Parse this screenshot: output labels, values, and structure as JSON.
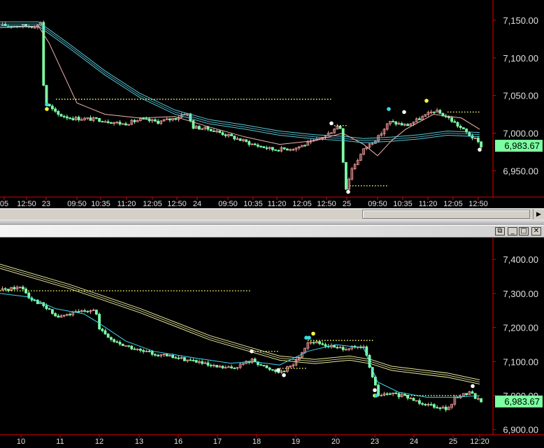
{
  "colors": {
    "background": "#000000",
    "axis": "#e00000",
    "axis_text": "#e0e0e0",
    "up_candle": "#f09a9a",
    "down_candle": "#7dffa6",
    "ma_band": "#57c7d8",
    "ma_slow": "#e7e79c",
    "fast_line_top": "#f4b3b3",
    "fast_line_bottom": "#3bd6f0",
    "level": "#ffff66",
    "last_price_bg": "#7bffa0",
    "dot_cyan": "#33dddd",
    "dot_yellow": "#ffff33",
    "dot_white": "#ffffff"
  },
  "icons": {
    "scroll_right": "triangle-right-icon",
    "restore": "restore-icon",
    "minimize": "minimize-icon",
    "maximize": "maximize-icon",
    "close": "close-icon"
  },
  "window_controls": {
    "restore": "⧉",
    "minimize": "_",
    "maximize": "□",
    "close": "✕"
  },
  "scroll_right_glyph": "▶",
  "chart_data": [
    {
      "type": "candlestick",
      "ylim": [
        6915,
        7175
      ],
      "grid": false,
      "y_ticks": [
        7150,
        7100,
        7050,
        7000,
        6950
      ],
      "y_tick_labels": [
        "7,150.00",
        "7,100.00",
        "7,050.00",
        "7,000.00",
        "6,950.00"
      ],
      "last_price": 6983.67,
      "last_price_label": "6,983.67",
      "x_labels": [
        "05",
        "12:50",
        "23",
        "09:50",
        "10:35",
        "11:20",
        "12:05",
        "12:50",
        "24",
        "09:50",
        "10:35",
        "11:20",
        "12:05",
        "12:50",
        "25",
        "09:50",
        "10:35",
        "11:20",
        "12:05",
        "12:50"
      ],
      "close_path": [
        [
          0,
          7143
        ],
        [
          20,
          7143
        ],
        [
          40,
          7142
        ],
        [
          55,
          7143
        ],
        [
          56,
          7162
        ],
        [
          60,
          7070
        ],
        [
          64,
          7040
        ],
        [
          80,
          7025
        ],
        [
          100,
          7020
        ],
        [
          140,
          7018
        ],
        [
          175,
          7012
        ],
        [
          200,
          7018
        ],
        [
          225,
          7015
        ],
        [
          250,
          7020
        ],
        [
          265,
          7028
        ],
        [
          275,
          7008
        ],
        [
          300,
          7005
        ],
        [
          330,
          6995
        ],
        [
          360,
          6985
        ],
        [
          390,
          6978
        ],
        [
          420,
          6980
        ],
        [
          450,
          6990
        ],
        [
          470,
          7000
        ],
        [
          480,
          7010
        ],
        [
          488,
          7005
        ],
        [
          490,
          6935
        ],
        [
          494,
          6925
        ],
        [
          500,
          6950
        ],
        [
          510,
          6965
        ],
        [
          520,
          6980
        ],
        [
          540,
          6995
        ],
        [
          555,
          7015
        ],
        [
          580,
          7010
        ],
        [
          600,
          7020
        ],
        [
          620,
          7030
        ],
        [
          640,
          7020
        ],
        [
          660,
          7005
        ],
        [
          680,
          6990
        ],
        [
          686,
          6983
        ]
      ],
      "series": [
        {
          "values": [
            [
              0,
              7145
            ],
            [
              55,
              7145
            ],
            [
              100,
              7115
            ],
            [
              150,
              7080
            ],
            [
              200,
              7050
            ],
            [
              250,
              7028
            ],
            [
              300,
              7015
            ],
            [
              350,
              7008
            ],
            [
              400,
              7000
            ],
            [
              450,
              6995
            ],
            [
              490,
              6993
            ],
            [
              520,
              6990
            ],
            [
              560,
              6992
            ],
            [
              600,
              6995
            ],
            [
              640,
              7000
            ],
            [
              686,
              6998
            ]
          ],
          "style": "band",
          "color": "#57c7d8"
        },
        {
          "values": [
            [
              0,
              7140
            ],
            [
              55,
              7142
            ],
            [
              70,
              7120
            ],
            [
              90,
              7080
            ],
            [
              110,
              7040
            ],
            [
              150,
              7025
            ],
            [
              200,
              7020
            ],
            [
              250,
              7022
            ],
            [
              300,
              7008
            ],
            [
              350,
              6995
            ],
            [
              400,
              6985
            ],
            [
              450,
              6990
            ],
            [
              490,
              7000
            ],
            [
              520,
              6985
            ],
            [
              540,
              6970
            ],
            [
              560,
              6990
            ],
            [
              580,
              7005
            ],
            [
              620,
              7025
            ],
            [
              660,
              7020
            ],
            [
              686,
              7005
            ]
          ],
          "style": "line",
          "color": "#f4b3b3"
        }
      ],
      "levels": [
        {
          "y": 7045,
          "x": [
            80,
            476
          ]
        },
        {
          "y": 7010,
          "x": [
            478,
            498
          ]
        },
        {
          "y": 6930,
          "x": [
            500,
            556
          ]
        },
        {
          "y": 7028,
          "x": [
            640,
            688
          ]
        }
      ],
      "markers": [
        {
          "x": 67,
          "y": 7038,
          "color": "cyan"
        },
        {
          "x": 67,
          "y": 7032,
          "color": "yellow"
        },
        {
          "x": 474,
          "y": 7013,
          "color": "white"
        },
        {
          "x": 498,
          "y": 6922,
          "color": "white"
        },
        {
          "x": 556,
          "y": 7032,
          "color": "cyan"
        },
        {
          "x": 578,
          "y": 7028,
          "color": "white"
        },
        {
          "x": 610,
          "y": 7043,
          "color": "yellow"
        },
        {
          "x": 686,
          "y": 6978,
          "color": "white"
        }
      ]
    },
    {
      "type": "candlestick",
      "ylim": [
        6885,
        7460
      ],
      "grid": false,
      "y_ticks": [
        7400,
        7300,
        7200,
        7100,
        7000,
        6900
      ],
      "y_tick_labels": [
        "7,400.00",
        "7,300.00",
        "7,200.00",
        "7,100.00",
        "7,000.00",
        "6,900.00"
      ],
      "last_price": 6983.67,
      "last_price_label": "6,983.67",
      "x_labels": [
        "10",
        "11",
        "12",
        "13",
        "16",
        "17",
        "18",
        "19",
        "20",
        "23",
        "24",
        "25",
        "12:20"
      ],
      "close_path": [
        [
          0,
          7310
        ],
        [
          30,
          7320
        ],
        [
          40,
          7290
        ],
        [
          60,
          7265
        ],
        [
          80,
          7230
        ],
        [
          100,
          7240
        ],
        [
          120,
          7250
        ],
        [
          135,
          7255
        ],
        [
          140,
          7195
        ],
        [
          160,
          7160
        ],
        [
          200,
          7130
        ],
        [
          240,
          7115
        ],
        [
          280,
          7100
        ],
        [
          300,
          7085
        ],
        [
          330,
          7080
        ],
        [
          360,
          7105
        ],
        [
          380,
          7080
        ],
        [
          400,
          7070
        ],
        [
          420,
          7095
        ],
        [
          440,
          7160
        ],
        [
          460,
          7150
        ],
        [
          480,
          7140
        ],
        [
          500,
          7140
        ],
        [
          520,
          7140
        ],
        [
          530,
          7060
        ],
        [
          540,
          7000
        ],
        [
          560,
          7005
        ],
        [
          580,
          6995
        ],
        [
          600,
          6980
        ],
        [
          620,
          6970
        ],
        [
          640,
          6960
        ],
        [
          650,
          6995
        ],
        [
          670,
          7010
        ],
        [
          686,
          6983
        ]
      ],
      "series": [
        {
          "values": [
            [
              0,
              7380
            ],
            [
              100,
              7320
            ],
            [
              200,
              7250
            ],
            [
              300,
              7170
            ],
            [
              400,
              7110
            ],
            [
              450,
              7100
            ],
            [
              500,
              7110
            ],
            [
              530,
              7100
            ],
            [
              560,
              7080
            ],
            [
              600,
              7070
            ],
            [
              640,
              7060
            ],
            [
              686,
              7040
            ]
          ],
          "style": "band",
          "color": "#e7e79c"
        },
        {
          "values": [
            [
              0,
              7300
            ],
            [
              40,
              7290
            ],
            [
              80,
              7255
            ],
            [
              120,
              7240
            ],
            [
              140,
              7215
            ],
            [
              180,
              7160
            ],
            [
              220,
              7130
            ],
            [
              280,
              7110
            ],
            [
              330,
              7095
            ],
            [
              360,
              7100
            ],
            [
              400,
              7090
            ],
            [
              440,
              7130
            ],
            [
              480,
              7150
            ],
            [
              520,
              7140
            ],
            [
              540,
              7040
            ],
            [
              570,
              7010
            ],
            [
              610,
              6995
            ],
            [
              650,
              6995
            ],
            [
              686,
              7000
            ]
          ],
          "style": "line",
          "color": "#3bd6f0"
        }
      ],
      "levels": [
        {
          "y": 7308,
          "x": [
            0,
            360
          ]
        },
        {
          "y": 7130,
          "x": [
            360,
            398
          ]
        },
        {
          "y": 7080,
          "x": [
            400,
            440
          ]
        },
        {
          "y": 7162,
          "x": [
            440,
            536
          ]
        },
        {
          "y": 7000,
          "x": [
            580,
            660
          ]
        }
      ],
      "markers": [
        {
          "x": 360,
          "y": 7130,
          "color": "white"
        },
        {
          "x": 398,
          "y": 7075,
          "color": "white"
        },
        {
          "x": 406,
          "y": 7060,
          "color": "white"
        },
        {
          "x": 438,
          "y": 7170,
          "color": "cyan"
        },
        {
          "x": 442,
          "y": 7170,
          "color": "cyan"
        },
        {
          "x": 448,
          "y": 7182,
          "color": "yellow"
        },
        {
          "x": 536,
          "y": 7000,
          "color": "yellow"
        },
        {
          "x": 538,
          "y": 7000,
          "color": "cyan"
        },
        {
          "x": 536,
          "y": 7016,
          "color": "white"
        },
        {
          "x": 676,
          "y": 7028,
          "color": "white"
        }
      ]
    }
  ]
}
